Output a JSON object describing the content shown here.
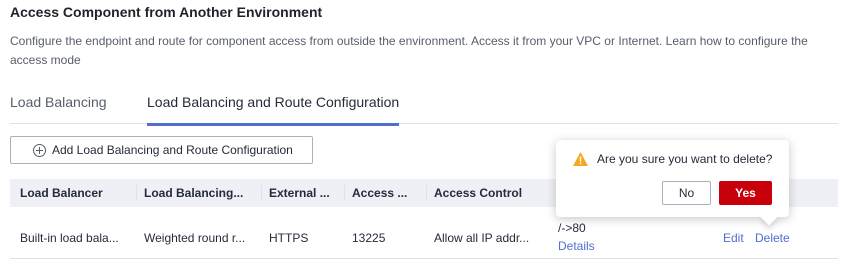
{
  "section": {
    "title": "Access Component from Another Environment",
    "description": "Configure the endpoint and route for component access from outside the environment. Access it from your VPC or Internet. Learn how to configure the access mode"
  },
  "tabs": [
    {
      "label": "Load Balancing",
      "active": false
    },
    {
      "label": "Load Balancing and Route Configuration",
      "active": true
    }
  ],
  "toolbar": {
    "add_label": "Add Load Balancing and Route Configuration"
  },
  "table": {
    "columns": [
      "Load Balancer",
      "Load Balancing...",
      "External ...",
      "Access ...",
      "Access Control"
    ],
    "rows": [
      {
        "load_balancer": "Built-in load bala...",
        "load_balancing": "Weighted round r...",
        "external": "HTTPS",
        "access": "13225",
        "access_control": "Allow all IP addr...",
        "route": "/->80",
        "details_label": "Details",
        "edit_label": "Edit",
        "delete_label": "Delete"
      }
    ]
  },
  "popover": {
    "message": "Are you sure you want to delete?",
    "no_label": "No",
    "yes_label": "Yes",
    "icon": "warning-icon"
  },
  "colors": {
    "accent": "#526ecc",
    "danger": "#c7000b",
    "warning": "#f5a623"
  }
}
